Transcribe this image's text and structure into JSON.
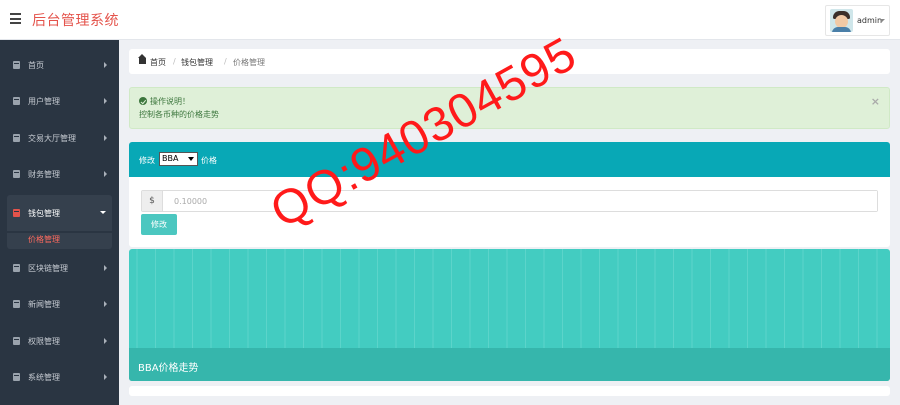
{
  "header": {
    "title": "后台管理系统",
    "username": "admin"
  },
  "sidebar": {
    "items": [
      {
        "label": "首页"
      },
      {
        "label": "用户管理"
      },
      {
        "label": "交易大厅管理"
      },
      {
        "label": "财务管理"
      },
      {
        "label": "钱包管理",
        "active": true
      },
      {
        "label": "区块链管理"
      },
      {
        "label": "新闻管理"
      },
      {
        "label": "权限管理"
      },
      {
        "label": "系统管理"
      }
    ],
    "active_sub": "价格管理"
  },
  "breadcrumb": [
    "首页",
    "钱包管理",
    "价格管理"
  ],
  "alert": {
    "title": "操作说明！",
    "description": "控制各币种的价格走势",
    "close": "×"
  },
  "edit_panel": {
    "prefix": "修改",
    "currency_selected": "BBA",
    "suffix": "价格",
    "currency_symbol": "$",
    "price_placeholder": "0.10000",
    "submit_label": "修改"
  },
  "chart_panel": {
    "caption": "BBA价格走势"
  },
  "watermark": "QQ:940304595",
  "colors": {
    "brand": "#e4534b",
    "sidebar_bg": "#2a3542",
    "panel_header": "#08a8b6",
    "chart_bg": "#43ccc1",
    "chart_footer": "#36b6ac",
    "alert_bg": "#dff0d8",
    "watermark": "#ff1a1a"
  },
  "icons": {
    "menu": "hamburger-icon",
    "sidebar_item": "book-icon",
    "breadcrumb_home": "home-icon",
    "alert": "check-circle-icon"
  }
}
